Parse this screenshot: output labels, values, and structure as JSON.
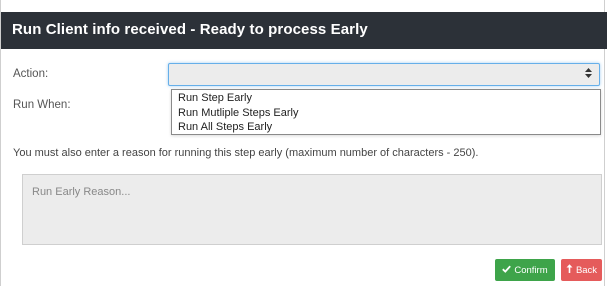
{
  "modal": {
    "title": "Run Client info received - Ready to process Early"
  },
  "form": {
    "action_label": "Action:",
    "run_when_label": "Run When:",
    "action_value": "",
    "action_options": [
      "Run Step Early",
      "Run Mutliple Steps Early",
      "Run All Steps Early"
    ],
    "note": "You must also enter a reason for running this step early (maximum number of characters - 250).",
    "reason_placeholder": "Run Early Reason..."
  },
  "buttons": {
    "confirm_label": "Confirm",
    "back_label": "Back"
  },
  "icons": {
    "confirm": "check-icon",
    "back": "back-arrow-icon",
    "select": "sort-arrows-icon"
  },
  "colors": {
    "header_bg": "#2c3138",
    "confirm": "#3ea44a",
    "back": "#e55b5b",
    "focus": "#66afe9"
  }
}
